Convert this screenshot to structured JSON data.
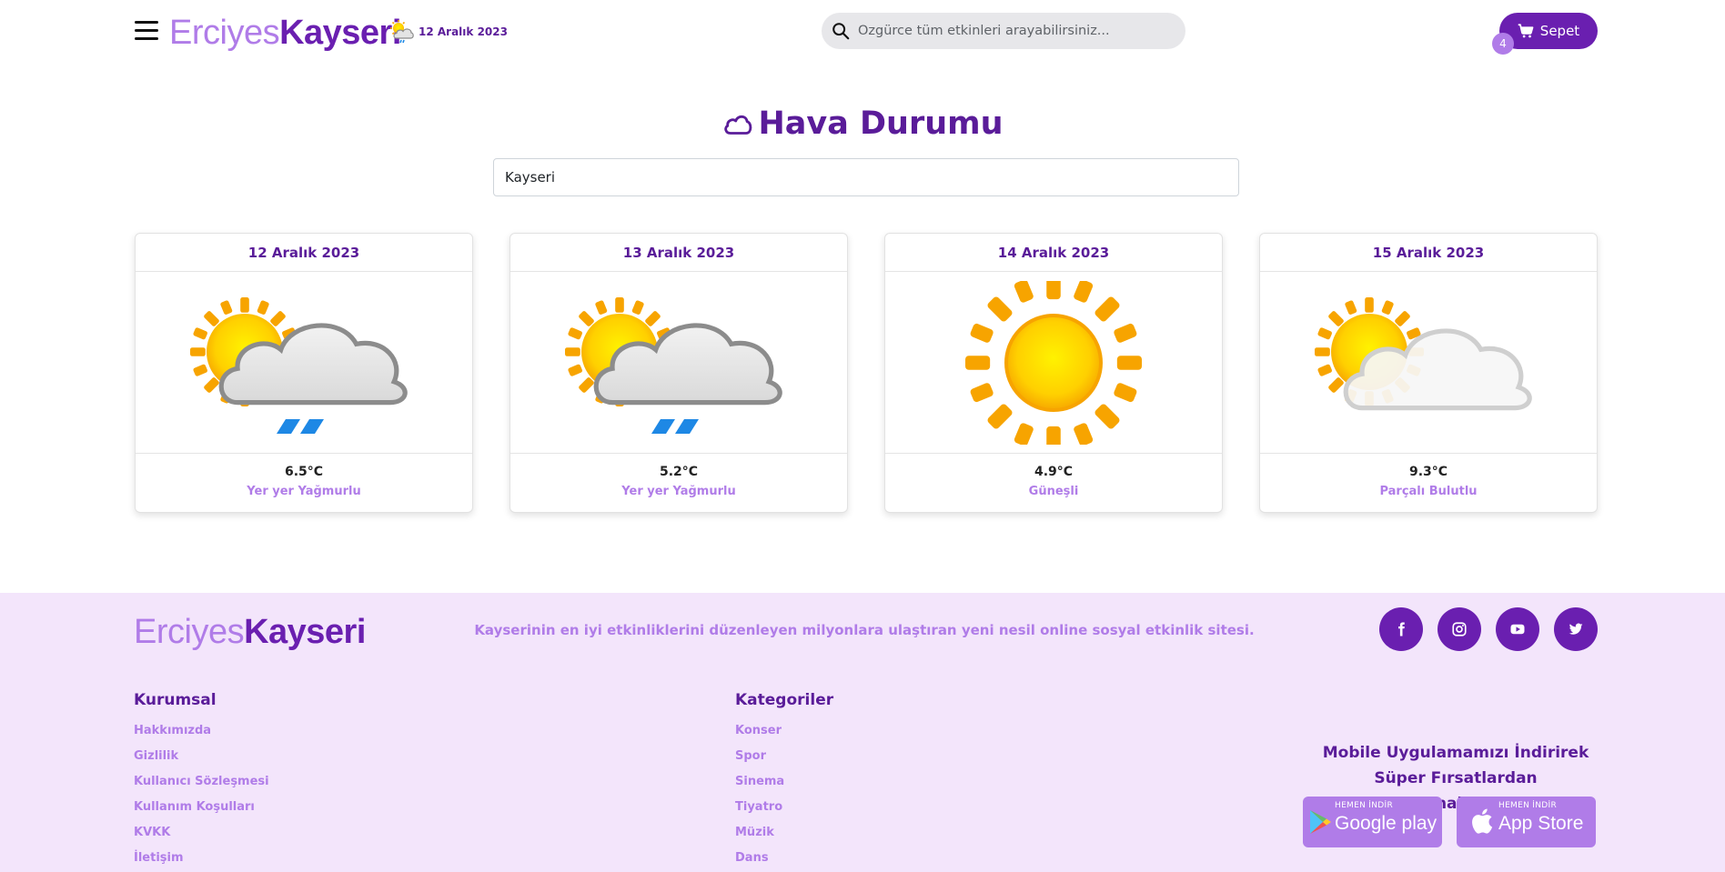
{
  "header": {
    "logo_light": "Erciyes",
    "logo_bold": "Kayseri",
    "weather_date": "12 Aralık 2023",
    "weather_icon": "sun-cloud-rain-icon",
    "search_placeholder": "Özgürce tüm etkinleri arayabilirsiniz...",
    "cart_label": "Sepet",
    "cart_count": "4"
  },
  "main": {
    "title": "Hava Durumu",
    "city_value": "Kayseri",
    "forecast": [
      {
        "date": "12 Aralık 2023",
        "temp": "6.5°C",
        "desc": "Yer yer Yağmurlu",
        "icon": "sun-cloud-rain"
      },
      {
        "date": "13 Aralık 2023",
        "temp": "5.2°C",
        "desc": "Yer yer Yağmurlu",
        "icon": "sun-cloud-rain"
      },
      {
        "date": "14 Aralık 2023",
        "temp": "4.9°C",
        "desc": "Güneşli",
        "icon": "sun"
      },
      {
        "date": "15 Aralık 2023",
        "temp": "9.3°C",
        "desc": "Parçalı Bulutlu",
        "icon": "sun-cloud"
      }
    ]
  },
  "footer": {
    "logo_light": "Erciyes",
    "logo_bold": "Kayseri",
    "tagline": "Kayserinin en iyi etkinliklerini düzenleyen milyonlara ulaştıran yeni nesil online sosyal etkinlik sitesi.",
    "socials": [
      "facebook-icon",
      "instagram-icon",
      "youtube-icon",
      "twitter-icon"
    ],
    "kurumsal": {
      "title": "Kurumsal",
      "links": [
        "Hakkımızda",
        "Gizlilik",
        "Kullanıcı Sözleşmesi",
        "Kullanım Koşulları",
        "KVKK",
        "İletişim"
      ]
    },
    "kategoriler": {
      "title": "Kategoriler",
      "links": [
        "Konser",
        "Spor",
        "Sinema",
        "Tiyatro",
        "Müzik",
        "Dans"
      ]
    },
    "mobile_line1": "Mobile Uygulamamızı İndirirek",
    "mobile_line2": "Süper Fırsatlardan Yararlanabilirsiniz.",
    "google_small": "HEMEN İNDİR",
    "google_big": "Google play",
    "apple_small": "HEMEN İNDİR",
    "apple_big": "App Store"
  },
  "colors": {
    "primary": "#6a1fb0",
    "light_purple": "#b07ce8",
    "footer_bg": "#f3e5fb"
  }
}
